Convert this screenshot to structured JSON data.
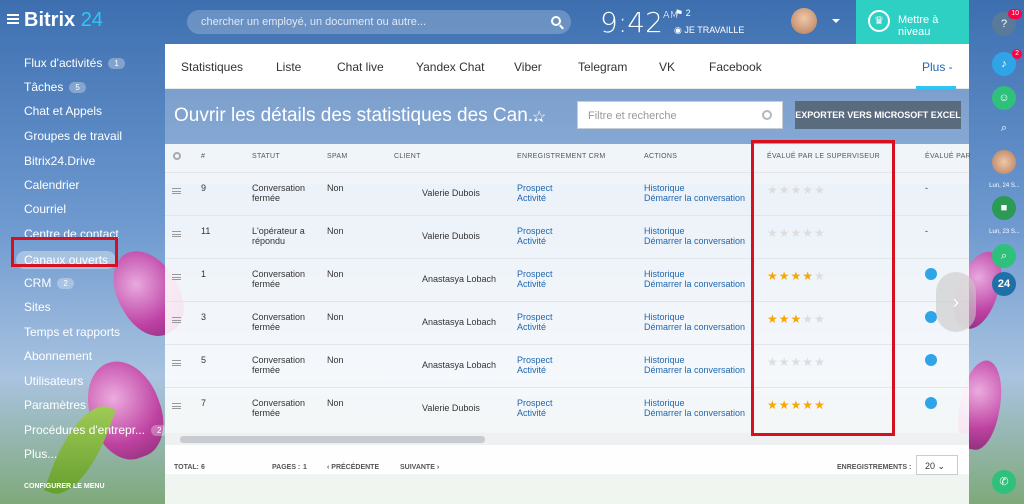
{
  "app": {
    "logo_main": "Bitrix",
    "logo_num": "24"
  },
  "header": {
    "search_placeholder": "chercher un employé, un document ou autre...",
    "time": "9:42",
    "ampm": "AM",
    "flag_count": "2",
    "work_status": "JE TRAVAILLE",
    "upgrade_label": "Mettre à niveau"
  },
  "menu": {
    "items": [
      {
        "label": "Flux d'activités",
        "count": "1"
      },
      {
        "label": "Tâches",
        "count": "5"
      },
      {
        "label": "Chat et Appels",
        "count": ""
      },
      {
        "label": "Groupes de travail",
        "count": ""
      },
      {
        "label": "Bitrix24.Drive",
        "count": ""
      },
      {
        "label": "Calendrier",
        "count": ""
      },
      {
        "label": "Courriel",
        "count": ""
      },
      {
        "label": "Centre de contact",
        "count": ""
      },
      {
        "label": "Canaux ouverts",
        "count": ""
      },
      {
        "label": "CRM",
        "count": "2"
      },
      {
        "label": "Sites",
        "count": ""
      },
      {
        "label": "Temps et rapports",
        "count": ""
      },
      {
        "label": "Abonnement",
        "count": ""
      },
      {
        "label": "Utilisateurs",
        "count": ""
      },
      {
        "label": "Paramètres",
        "count": ""
      },
      {
        "label": "Procédures d'entrepr...",
        "count": "2"
      },
      {
        "label": "Plus...",
        "count": ""
      }
    ],
    "config_label": "CONFIGURER LE MENU"
  },
  "tabs": [
    "Statistiques",
    "Liste",
    "Chat live",
    "Yandex Chat",
    "Viber",
    "Telegram",
    "VK",
    "Facebook",
    "Plus -"
  ],
  "page": {
    "title": "Ouvrir les détails des statistiques des Can...",
    "filter_placeholder": "Filtre et recherche",
    "export_label": "EXPORTER VERS MICROSOFT EXCEL"
  },
  "columns": [
    "#",
    "STATUT",
    "SPAM",
    "CLIENT",
    "ENREGISTREMENT CRM",
    "ACTIONS",
    "ÉVALUÉ PAR LE SUPERVISEUR",
    "ÉVALUÉ PAR"
  ],
  "rows": [
    {
      "num": "9",
      "status1": "Conversation",
      "status2": "fermée",
      "spam": "Non",
      "client": "Valerie Dubois",
      "crm1": "Prospect",
      "crm2": "Activité",
      "act1": "Historique",
      "act2": "Démarrer la conversation",
      "rating": 0,
      "client_rating": "-"
    },
    {
      "num": "11",
      "status1": "L'opérateur a",
      "status2": "répondu",
      "spam": "Non",
      "client": "Valerie Dubois",
      "crm1": "Prospect",
      "crm2": "Activité",
      "act1": "Historique",
      "act2": "Démarrer la conversation",
      "rating": 0,
      "client_rating": "-"
    },
    {
      "num": "1",
      "status1": "Conversation",
      "status2": "fermée",
      "spam": "Non",
      "client": "Anastasya Lobach",
      "crm1": "Prospect",
      "crm2": "Activité",
      "act1": "Historique",
      "act2": "Démarrer la conversation",
      "rating": 4,
      "client_rating": "like"
    },
    {
      "num": "3",
      "status1": "Conversation",
      "status2": "fermée",
      "spam": "Non",
      "client": "Anastasya Lobach",
      "crm1": "Prospect",
      "crm2": "Activité",
      "act1": "Historique",
      "act2": "Démarrer la conversation",
      "rating": 3,
      "client_rating": "like"
    },
    {
      "num": "5",
      "status1": "Conversation",
      "status2": "fermée",
      "spam": "Non",
      "client": "Anastasya Lobach",
      "crm1": "Prospect",
      "crm2": "Activité",
      "act1": "Historique",
      "act2": "Démarrer la conversation",
      "rating": 0,
      "client_rating": "like"
    },
    {
      "num": "7",
      "status1": "Conversation",
      "status2": "fermée",
      "spam": "Non",
      "client": "Valerie Dubois",
      "crm1": "Prospect",
      "crm2": "Activité",
      "act1": "Historique",
      "act2": "Démarrer la conversation",
      "rating": 5,
      "client_rating": "like"
    }
  ],
  "footer": {
    "total": "TOTAL: 6",
    "pages_label": "PAGES :",
    "page_num": "1",
    "prev": "PRÉCÉDENTE",
    "next": "SUIVANTE",
    "records_label": "ENREGISTREMENTS :",
    "page_size": "20"
  },
  "rail": {
    "help_badge": "10",
    "bell_badge": "2",
    "date1": "Lun, 24 S...",
    "date2": "Lun, 23 S...",
    "b24": "24"
  },
  "colors": {
    "accent": "#2fc6f6",
    "upgrade": "#2fd0c4",
    "highlight": "#d6101f",
    "star_on": "#f7a700"
  }
}
